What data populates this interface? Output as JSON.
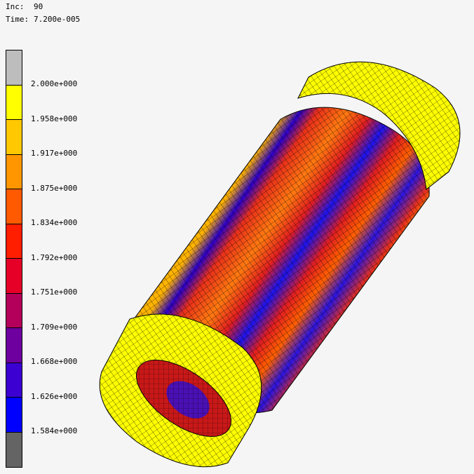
{
  "header": {
    "inc_label": "Inc:",
    "inc_value": "90",
    "time_label": "Time:",
    "time_value": "7.200e-005"
  },
  "legend": {
    "colors": [
      "#bdbdbd",
      "#ffff00",
      "#ffc800",
      "#ff9600",
      "#ff5a00",
      "#ff1e00",
      "#e60028",
      "#b4005a",
      "#6e00a0",
      "#3c00d2",
      "#0000ff",
      "#646464"
    ],
    "ticks": [
      "2.000e+000",
      "1.958e+000",
      "1.917e+000",
      "1.875e+000",
      "1.834e+000",
      "1.792e+000",
      "1.751e+000",
      "1.709e+000",
      "1.668e+000",
      "1.626e+000",
      "1.584e+000"
    ]
  }
}
